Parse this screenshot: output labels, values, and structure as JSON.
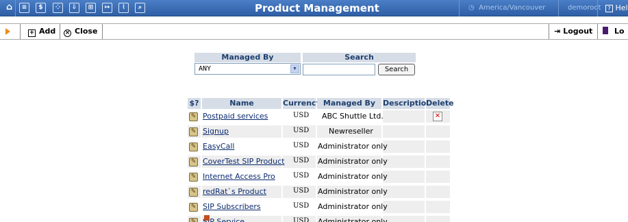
{
  "header": {
    "nav_icons": [
      "home-icon",
      "list-icon",
      "dollar-icon",
      "grid-icon",
      "plus-box-icon",
      "tree-icon",
      "forward-icon",
      "chart-icon",
      "magnifier-icon"
    ],
    "title": "Product Management",
    "timezone": "America/Vancouver",
    "user": "demoroot",
    "help": "Hel"
  },
  "toolbar": {
    "add_label": "Add",
    "close_label": "Close",
    "logout_label": "Logout",
    "log_label": "Lo"
  },
  "filter": {
    "managed_by_header": "Managed By",
    "search_header": "Search",
    "managed_by_value": "ANY",
    "search_value": "",
    "search_button": "Search"
  },
  "table": {
    "columns": [
      "$?",
      "Name",
      "Currency",
      "Managed By",
      "Description",
      "Delete"
    ],
    "rows": [
      {
        "name": "Postpaid services",
        "currency": "USD",
        "managed_by": "ABC Shuttle Ltd.",
        "description": "",
        "deletable": true
      },
      {
        "name": "Signup",
        "currency": "USD",
        "managed_by": "Newreseller",
        "description": "",
        "deletable": false
      },
      {
        "name": "EasyCall",
        "currency": "USD",
        "managed_by": "Administrator only",
        "description": "",
        "deletable": false
      },
      {
        "name": "CoverTest SIP Product",
        "currency": "USD",
        "managed_by": "Administrator only",
        "description": "",
        "deletable": false
      },
      {
        "name": "Internet Access Pro",
        "currency": "USD",
        "managed_by": "Administrator only",
        "description": "",
        "deletable": false
      },
      {
        "name": "redRat`s Product",
        "currency": "USD",
        "managed_by": "Administrator only",
        "description": "",
        "deletable": false
      },
      {
        "name": "SIP Subscribers",
        "currency": "USD",
        "managed_by": "Administrator only",
        "description": "",
        "deletable": false
      },
      {
        "name": "SIP Service",
        "currency": "USD",
        "managed_by": "Administrator only",
        "description": "",
        "deletable": false
      }
    ]
  }
}
